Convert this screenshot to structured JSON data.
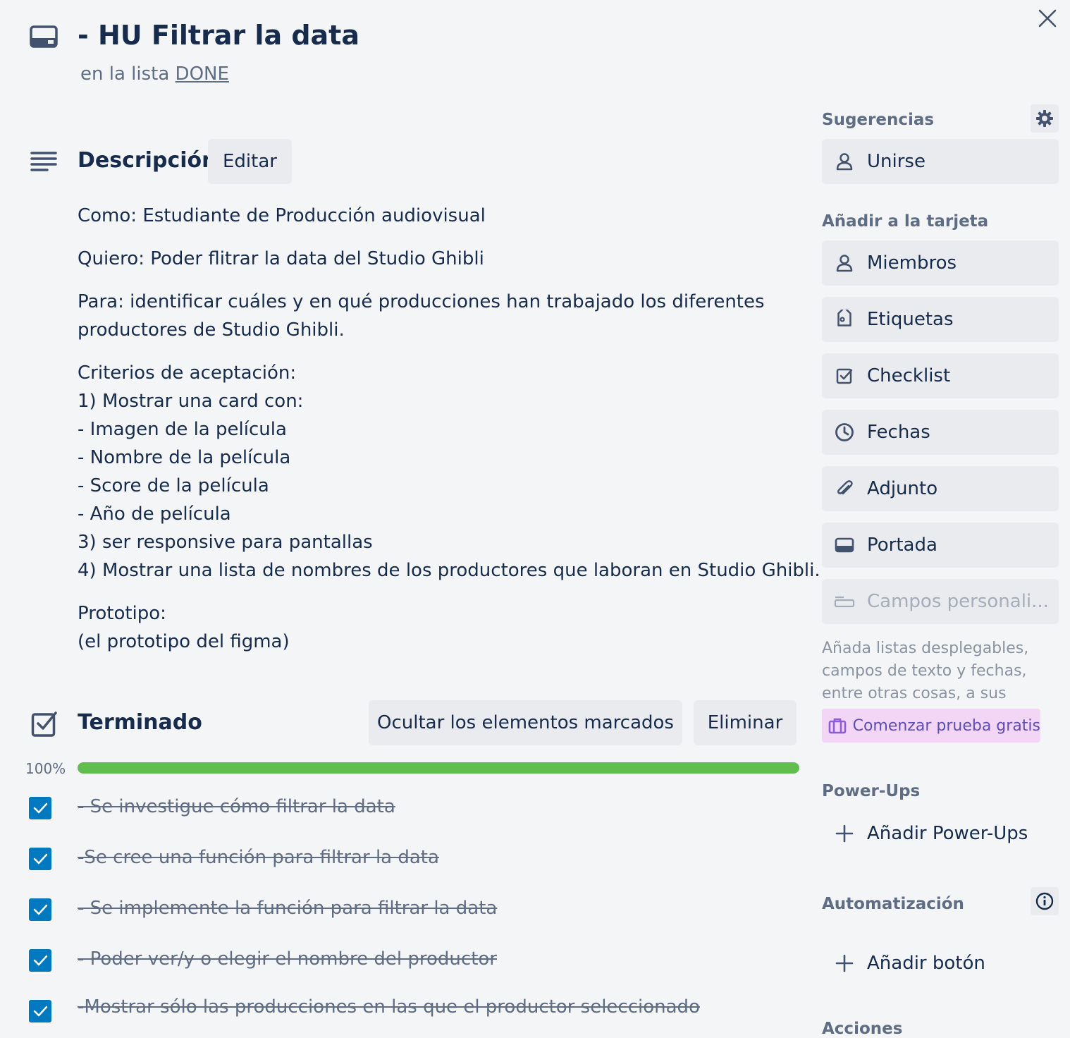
{
  "card": {
    "title": "- HU Filtrar la data",
    "in_list_prefix": "en la lista",
    "list_name": "DONE"
  },
  "description": {
    "heading": "Descripción",
    "edit_label": "Editar",
    "paragraphs": [
      [
        "Como: Estudiante de Producción audiovisual"
      ],
      [
        "Quiero: Poder flitrar la data del Studio Ghibli"
      ],
      [
        "Para: identificar cuáles y en qué producciones han trabajado los diferentes",
        "productores de Studio Ghibli."
      ],
      [
        "Criterios de aceptación:",
        "1) Mostrar una card con:",
        "- Imagen de la película",
        "- Nombre de la película",
        "- Score de la película",
        "- Año de película",
        "3) ser responsive para pantallas",
        "4) Mostrar una lista de nombres de los productores que laboran en Studio Ghibli."
      ],
      [
        "Prototipo:",
        "(el prototipo del figma)"
      ]
    ]
  },
  "checklist": {
    "heading": "Terminado",
    "hide_checked_label": "Ocultar los elementos marcados",
    "delete_label": "Eliminar",
    "progress_text": "100%",
    "progress_value": 1.0,
    "items": [
      {
        "text": "- Se investigue cómo filtrar la data",
        "checked": true
      },
      {
        "text": "-Se cree una función para filtrar la data",
        "checked": true
      },
      {
        "text": "- Se implemente la función para filtrar la data",
        "checked": true
      },
      {
        "text": "- Poder ver/y o elegir el nombre del productor",
        "checked": true
      },
      {
        "text": "-Mostrar sólo las producciones en las que el productor seleccionado",
        "checked": true
      }
    ]
  },
  "sidebar": {
    "suggestions_heading": "Sugerencias",
    "join_label": "Unirse",
    "add_to_card_heading": "Añadir a la tarjeta",
    "members_label": "Miembros",
    "labels_label": "Etiquetas",
    "checklist_label": "Checklist",
    "dates_label": "Fechas",
    "attachment_label": "Adjunto",
    "cover_label": "Portada",
    "custom_fields_label": "Campos personali...",
    "custom_fields_note": "Añada listas desplegables, campos de texto y fechas, entre otras cosas, a sus tarjetas.",
    "trial_label": "Comenzar prueba gratis",
    "powerups_heading": "Power-Ups",
    "add_powerups_label": "Añadir Power-Ups",
    "automation_heading": "Automatización",
    "add_button_label": "Añadir botón",
    "actions_heading": "Acciones"
  },
  "colors": {
    "accent": "#0079bf",
    "progress": "#61bd4f",
    "trial_bg": "#f3d6f5"
  }
}
